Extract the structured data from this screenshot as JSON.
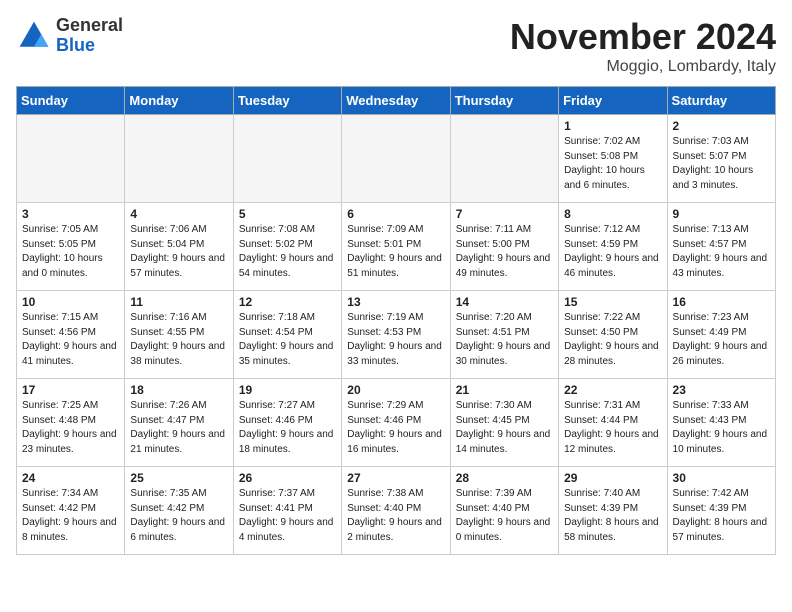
{
  "header": {
    "logo_line1": "General",
    "logo_line2": "Blue",
    "month_title": "November 2024",
    "location": "Moggio, Lombardy, Italy"
  },
  "weekdays": [
    "Sunday",
    "Monday",
    "Tuesday",
    "Wednesday",
    "Thursday",
    "Friday",
    "Saturday"
  ],
  "weeks": [
    [
      {
        "day": "",
        "info": ""
      },
      {
        "day": "",
        "info": ""
      },
      {
        "day": "",
        "info": ""
      },
      {
        "day": "",
        "info": ""
      },
      {
        "day": "",
        "info": ""
      },
      {
        "day": "1",
        "info": "Sunrise: 7:02 AM\nSunset: 5:08 PM\nDaylight: 10 hours\nand 6 minutes."
      },
      {
        "day": "2",
        "info": "Sunrise: 7:03 AM\nSunset: 5:07 PM\nDaylight: 10 hours\nand 3 minutes."
      }
    ],
    [
      {
        "day": "3",
        "info": "Sunrise: 7:05 AM\nSunset: 5:05 PM\nDaylight: 10 hours\nand 0 minutes."
      },
      {
        "day": "4",
        "info": "Sunrise: 7:06 AM\nSunset: 5:04 PM\nDaylight: 9 hours\nand 57 minutes."
      },
      {
        "day": "5",
        "info": "Sunrise: 7:08 AM\nSunset: 5:02 PM\nDaylight: 9 hours\nand 54 minutes."
      },
      {
        "day": "6",
        "info": "Sunrise: 7:09 AM\nSunset: 5:01 PM\nDaylight: 9 hours\nand 51 minutes."
      },
      {
        "day": "7",
        "info": "Sunrise: 7:11 AM\nSunset: 5:00 PM\nDaylight: 9 hours\nand 49 minutes."
      },
      {
        "day": "8",
        "info": "Sunrise: 7:12 AM\nSunset: 4:59 PM\nDaylight: 9 hours\nand 46 minutes."
      },
      {
        "day": "9",
        "info": "Sunrise: 7:13 AM\nSunset: 4:57 PM\nDaylight: 9 hours\nand 43 minutes."
      }
    ],
    [
      {
        "day": "10",
        "info": "Sunrise: 7:15 AM\nSunset: 4:56 PM\nDaylight: 9 hours\nand 41 minutes."
      },
      {
        "day": "11",
        "info": "Sunrise: 7:16 AM\nSunset: 4:55 PM\nDaylight: 9 hours\nand 38 minutes."
      },
      {
        "day": "12",
        "info": "Sunrise: 7:18 AM\nSunset: 4:54 PM\nDaylight: 9 hours\nand 35 minutes."
      },
      {
        "day": "13",
        "info": "Sunrise: 7:19 AM\nSunset: 4:53 PM\nDaylight: 9 hours\nand 33 minutes."
      },
      {
        "day": "14",
        "info": "Sunrise: 7:20 AM\nSunset: 4:51 PM\nDaylight: 9 hours\nand 30 minutes."
      },
      {
        "day": "15",
        "info": "Sunrise: 7:22 AM\nSunset: 4:50 PM\nDaylight: 9 hours\nand 28 minutes."
      },
      {
        "day": "16",
        "info": "Sunrise: 7:23 AM\nSunset: 4:49 PM\nDaylight: 9 hours\nand 26 minutes."
      }
    ],
    [
      {
        "day": "17",
        "info": "Sunrise: 7:25 AM\nSunset: 4:48 PM\nDaylight: 9 hours\nand 23 minutes."
      },
      {
        "day": "18",
        "info": "Sunrise: 7:26 AM\nSunset: 4:47 PM\nDaylight: 9 hours\nand 21 minutes."
      },
      {
        "day": "19",
        "info": "Sunrise: 7:27 AM\nSunset: 4:46 PM\nDaylight: 9 hours\nand 18 minutes."
      },
      {
        "day": "20",
        "info": "Sunrise: 7:29 AM\nSunset: 4:46 PM\nDaylight: 9 hours\nand 16 minutes."
      },
      {
        "day": "21",
        "info": "Sunrise: 7:30 AM\nSunset: 4:45 PM\nDaylight: 9 hours\nand 14 minutes."
      },
      {
        "day": "22",
        "info": "Sunrise: 7:31 AM\nSunset: 4:44 PM\nDaylight: 9 hours\nand 12 minutes."
      },
      {
        "day": "23",
        "info": "Sunrise: 7:33 AM\nSunset: 4:43 PM\nDaylight: 9 hours\nand 10 minutes."
      }
    ],
    [
      {
        "day": "24",
        "info": "Sunrise: 7:34 AM\nSunset: 4:42 PM\nDaylight: 9 hours\nand 8 minutes."
      },
      {
        "day": "25",
        "info": "Sunrise: 7:35 AM\nSunset: 4:42 PM\nDaylight: 9 hours\nand 6 minutes."
      },
      {
        "day": "26",
        "info": "Sunrise: 7:37 AM\nSunset: 4:41 PM\nDaylight: 9 hours\nand 4 minutes."
      },
      {
        "day": "27",
        "info": "Sunrise: 7:38 AM\nSunset: 4:40 PM\nDaylight: 9 hours\nand 2 minutes."
      },
      {
        "day": "28",
        "info": "Sunrise: 7:39 AM\nSunset: 4:40 PM\nDaylight: 9 hours\nand 0 minutes."
      },
      {
        "day": "29",
        "info": "Sunrise: 7:40 AM\nSunset: 4:39 PM\nDaylight: 8 hours\nand 58 minutes."
      },
      {
        "day": "30",
        "info": "Sunrise: 7:42 AM\nSunset: 4:39 PM\nDaylight: 8 hours\nand 57 minutes."
      }
    ]
  ]
}
